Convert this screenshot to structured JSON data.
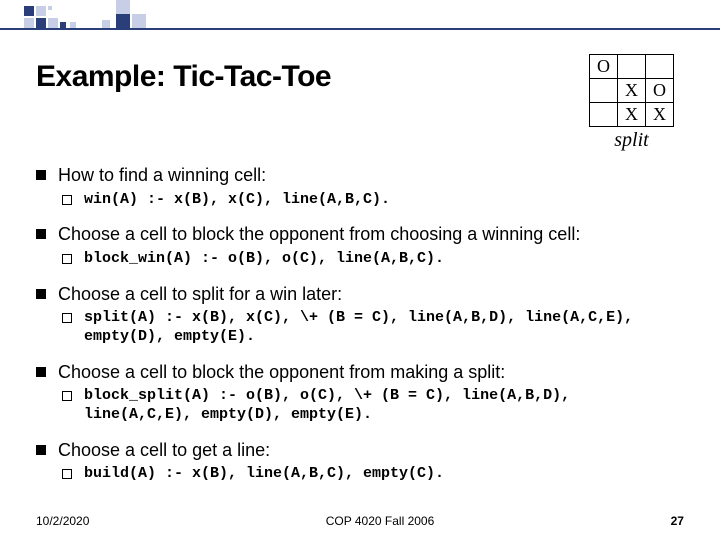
{
  "title": "Example: Tic-Tac-Toe",
  "ttt": {
    "cells": [
      [
        "O",
        "",
        ""
      ],
      [
        "",
        "X",
        "O"
      ],
      [
        "",
        "X",
        "X"
      ]
    ],
    "caption": "split"
  },
  "items": [
    {
      "text": "How to find a winning cell:",
      "code": "win(A) :- x(B), x(C), line(A,B,C)."
    },
    {
      "text": "Choose a cell to block the opponent from choosing a winning cell:",
      "code": "block_win(A) :- o(B), o(C), line(A,B,C)."
    },
    {
      "text": "Choose a cell to split for a win later:",
      "code": "split(A) :- x(B), x(C), \\+ (B = C), line(A,B,D), line(A,C,E), empty(D), empty(E)."
    },
    {
      "text": "Choose a cell to block the opponent from making a split:",
      "code": "block_split(A) :- o(B), o(C), \\+ (B = C), line(A,B,D), line(A,C,E), empty(D), empty(E)."
    },
    {
      "text": "Choose a cell to get a line:",
      "code": "build(A) :- x(B), line(A,B,C), empty(C)."
    }
  ],
  "footer": {
    "date": "10/2/2020",
    "course": "COP 4020 Fall 2006",
    "page": "27"
  }
}
